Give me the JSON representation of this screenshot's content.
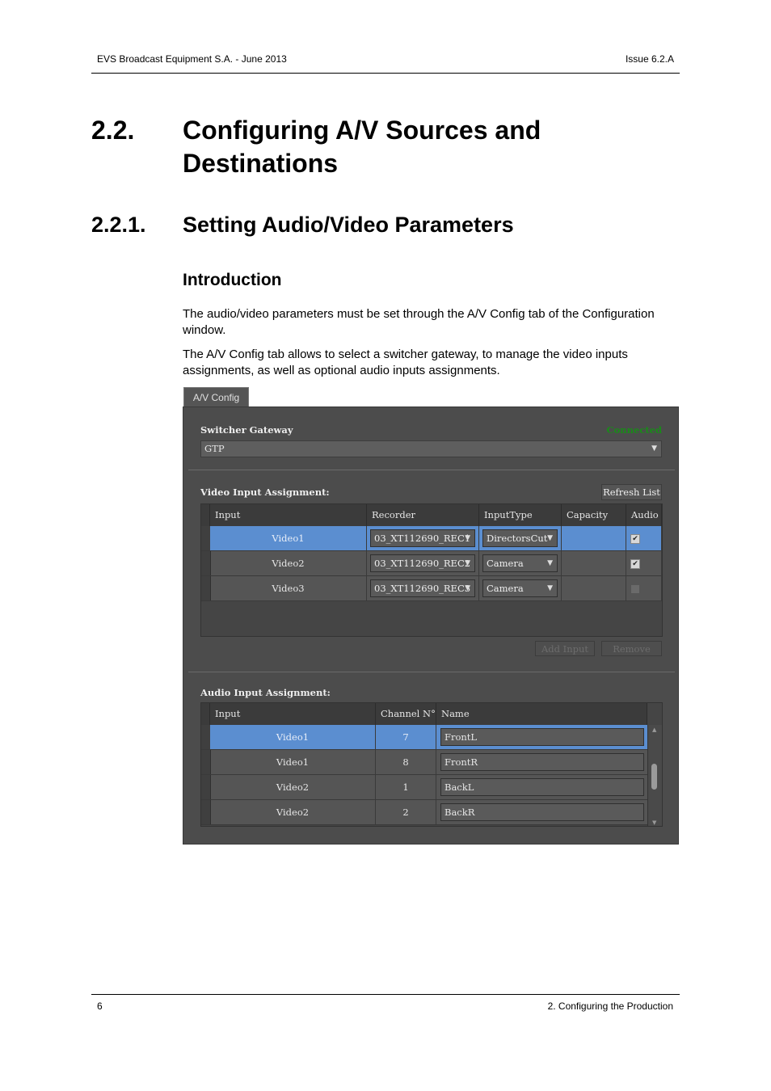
{
  "header": {
    "left": "EVS Broadcast Equipment S.A.  - June 2013",
    "right": "Issue 6.2.A"
  },
  "section": {
    "number": "2.2.",
    "title_line1": "Configuring A/V Sources and",
    "title_line2": "Destinations"
  },
  "subsection": {
    "number": "2.2.1.",
    "title": "Setting Audio/Video Parameters"
  },
  "intro": {
    "heading": "Introduction",
    "p1": "The audio/video parameters must be set through the A/V Config tab of the Configuration window.",
    "p2": "The A/V Config tab allows to select a switcher gateway, to manage the video inputs assignments, as well as optional audio inputs assignments."
  },
  "ui": {
    "tab_label": "A/V Config",
    "switcher_label": "Switcher Gateway",
    "switcher_status": "Connected",
    "switcher_value": "GTP",
    "video_label": "Video Input Assignment:",
    "refresh_label": "Refresh List",
    "video_headers": [
      "Input",
      "Recorder",
      "InputType",
      "Capacity",
      "Audio"
    ],
    "video_rows": [
      {
        "input": "Video1",
        "recorder": "03_XT112690_REC1",
        "type": "DirectorsCut",
        "capacity": "",
        "audio": true,
        "selected": true
      },
      {
        "input": "Video2",
        "recorder": "03_XT112690_REC2",
        "type": "Camera",
        "capacity": "",
        "audio": true,
        "selected": false
      },
      {
        "input": "Video3",
        "recorder": "03_XT112690_REC3",
        "type": "Camera",
        "capacity": "",
        "audio": false,
        "selected": false
      }
    ],
    "add_input_label": "Add Input",
    "remove_label": "Remove",
    "audio_label": "Audio Input Assignment:",
    "audio_headers": [
      "Input",
      "Channel N°",
      "Name"
    ],
    "audio_rows": [
      {
        "input": "Video1",
        "channel": "7",
        "name": "FrontL",
        "selected": true
      },
      {
        "input": "Video1",
        "channel": "8",
        "name": "FrontR",
        "selected": false
      },
      {
        "input": "Video2",
        "channel": "1",
        "name": "BackL",
        "selected": false
      },
      {
        "input": "Video2",
        "channel": "2",
        "name": "BackR",
        "selected": false
      }
    ]
  },
  "footer": {
    "page": "6",
    "chapter": "2. Configuring the Production"
  }
}
